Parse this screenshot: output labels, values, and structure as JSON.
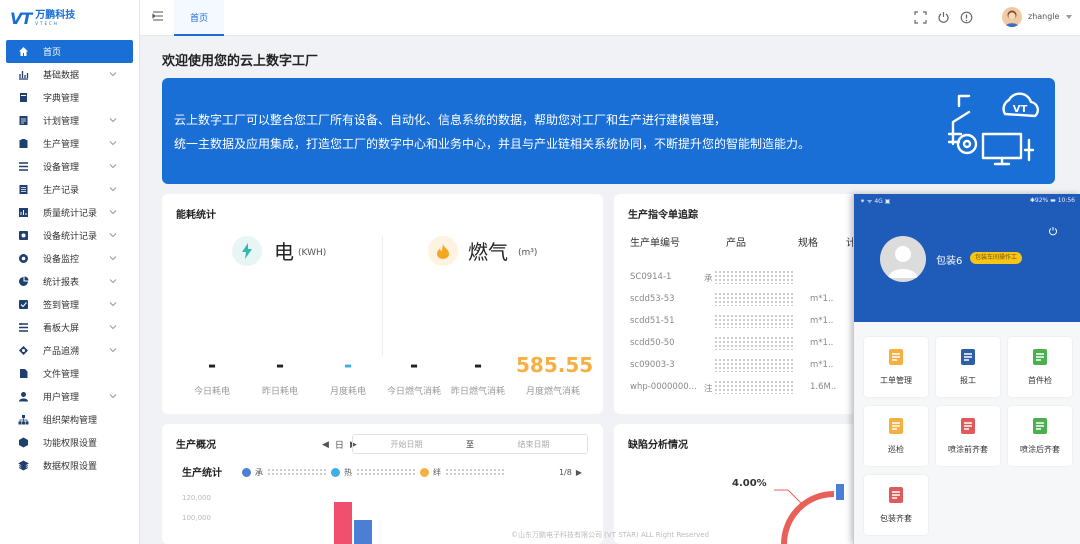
{
  "brand": {
    "mark": "VT",
    "name": "万鹏科技",
    "sub": "VTECH"
  },
  "sidebar": {
    "items": [
      {
        "label": "首页",
        "icon": "home-icon",
        "active": true,
        "expandable": false
      },
      {
        "label": "基础数据",
        "icon": "bar-chart-icon",
        "expandable": true
      },
      {
        "label": "字典管理",
        "icon": "dictionary-icon",
        "expandable": false
      },
      {
        "label": "计划管理",
        "icon": "plan-icon",
        "expandable": true
      },
      {
        "label": "生产管理",
        "icon": "production-icon",
        "expandable": true
      },
      {
        "label": "设备管理",
        "icon": "equipment-icon",
        "expandable": true
      },
      {
        "label": "生产记录",
        "icon": "record-icon",
        "expandable": true
      },
      {
        "label": "质量统计记录",
        "icon": "quality-icon",
        "expandable": true
      },
      {
        "label": "设备统计记录",
        "icon": "equipment-stats-icon",
        "expandable": true
      },
      {
        "label": "设备监控",
        "icon": "monitor-icon",
        "expandable": true
      },
      {
        "label": "统计报表",
        "icon": "pie-chart-icon",
        "expandable": true
      },
      {
        "label": "签到管理",
        "icon": "checkin-icon",
        "expandable": true
      },
      {
        "label": "看板大屏",
        "icon": "dashboard-icon",
        "expandable": true
      },
      {
        "label": "产品追溯",
        "icon": "trace-icon",
        "expandable": true
      },
      {
        "label": "文件管理",
        "icon": "file-icon",
        "expandable": false
      },
      {
        "label": "用户管理",
        "icon": "user-icon",
        "expandable": true
      },
      {
        "label": "组织架构管理",
        "icon": "org-chart-icon",
        "expandable": false
      },
      {
        "label": "功能权限设置",
        "icon": "function-permission-icon",
        "expandable": false
      },
      {
        "label": "数据权限设置",
        "icon": "data-permission-icon",
        "expandable": false
      }
    ]
  },
  "topbar": {
    "tab": "首页",
    "username": "zhangle",
    "icons": [
      "fold-menu-icon",
      "fullscreen-icon",
      "power-icon",
      "info-icon"
    ]
  },
  "main": {
    "welcome": "欢迎使用您的云上数字工厂",
    "banner": {
      "line1": "云上数字工厂可以整合您工厂所有设备、自动化、信息系统的数据，帮助您对工厂和生产进行建模管理，",
      "line2": "统一主数据及应用集成，打造您工厂的数字中心和业务中心，并且与产业链相关系统协同，不断提升您的智能制造能力。",
      "deco_text": "VT"
    }
  },
  "energy": {
    "title": "能耗统计",
    "electric": {
      "name": "电",
      "unit": "(KWH)",
      "stats": [
        {
          "value": "-",
          "label": "今日耗电"
        },
        {
          "value": "-",
          "label": "昨日耗电"
        },
        {
          "value": "-",
          "label": "月度耗电"
        }
      ]
    },
    "gas": {
      "name": "燃气",
      "unit": "(m³)",
      "stats": [
        {
          "value": "-",
          "label": "今日燃气消耗"
        },
        {
          "value": "-",
          "label": "昨日燃气消耗"
        },
        {
          "value": "585.55",
          "label": "月度燃气消耗"
        }
      ]
    }
  },
  "orders": {
    "title": "生产指令单追踪",
    "columns": [
      "生产单编号",
      "产品",
      "规格",
      "计"
    ],
    "rows": [
      {
        "id": "SC0914-1",
        "product": "承",
        "spec": ""
      },
      {
        "id": "scdd53-53",
        "product": "",
        "spec": "m*1.."
      },
      {
        "id": "scdd51-51",
        "product": "",
        "spec": "m*1.."
      },
      {
        "id": "scdd50-50",
        "product": "",
        "spec": "m*1.."
      },
      {
        "id": "sc09003-3",
        "product": "",
        "spec": "m*1.."
      },
      {
        "id": "whp-0000000...",
        "product": "注",
        "spec": "1.6M.."
      }
    ]
  },
  "overview": {
    "title": "生产概况",
    "period": "日",
    "start_placeholder": "开始日期",
    "to": "至",
    "end_placeholder": "结束日期",
    "subtitle": "生产统计",
    "legend": [
      {
        "color": "#4a7fd4",
        "label": "承"
      },
      {
        "color": "#3ab0e6",
        "label": "热"
      },
      {
        "color": "#f5b041",
        "label": "绊"
      }
    ],
    "pager": "1/8",
    "yticks": [
      "120,000",
      "100,000"
    ],
    "colors": {
      "bar_red": "#f0506e",
      "bar_blue": "#4a7fd4"
    }
  },
  "defect": {
    "title": "缺陷分析情况",
    "percent": "4.00%"
  },
  "footer": "©山东万鹏电子科技有限公司 (VT STAR) ALL Right Reserved",
  "phone": {
    "status_left": "⁕ ᯤ 4G ▣",
    "status_right": "✱92% ▬ 10:56",
    "name": "包装6",
    "role": "包装车间操作工",
    "tiles": [
      {
        "label": "工单管理",
        "icon": "work-order-icon",
        "color": "#f5b041"
      },
      {
        "label": "报工",
        "icon": "stopwatch-icon",
        "color": "#2d5ea8"
      },
      {
        "label": "首件检",
        "icon": "first-inspection-icon",
        "color": "#4caf50"
      },
      {
        "label": "巡检",
        "icon": "patrol-icon",
        "color": "#f5b041"
      },
      {
        "label": "喷涂前齐套",
        "icon": "pre-spray-kit-icon",
        "color": "#e05a5a"
      },
      {
        "label": "喷涂后齐套",
        "icon": "post-spray-kit-icon",
        "color": "#4caf50"
      },
      {
        "label": "包装齐套",
        "icon": "packaging-kit-icon",
        "color": "#e05a5a"
      }
    ]
  },
  "colors": {
    "primary": "#1a6fd6",
    "phone_header": "#1f5bb8",
    "gold": "#f5b041",
    "sky": "#3ab0e6"
  }
}
